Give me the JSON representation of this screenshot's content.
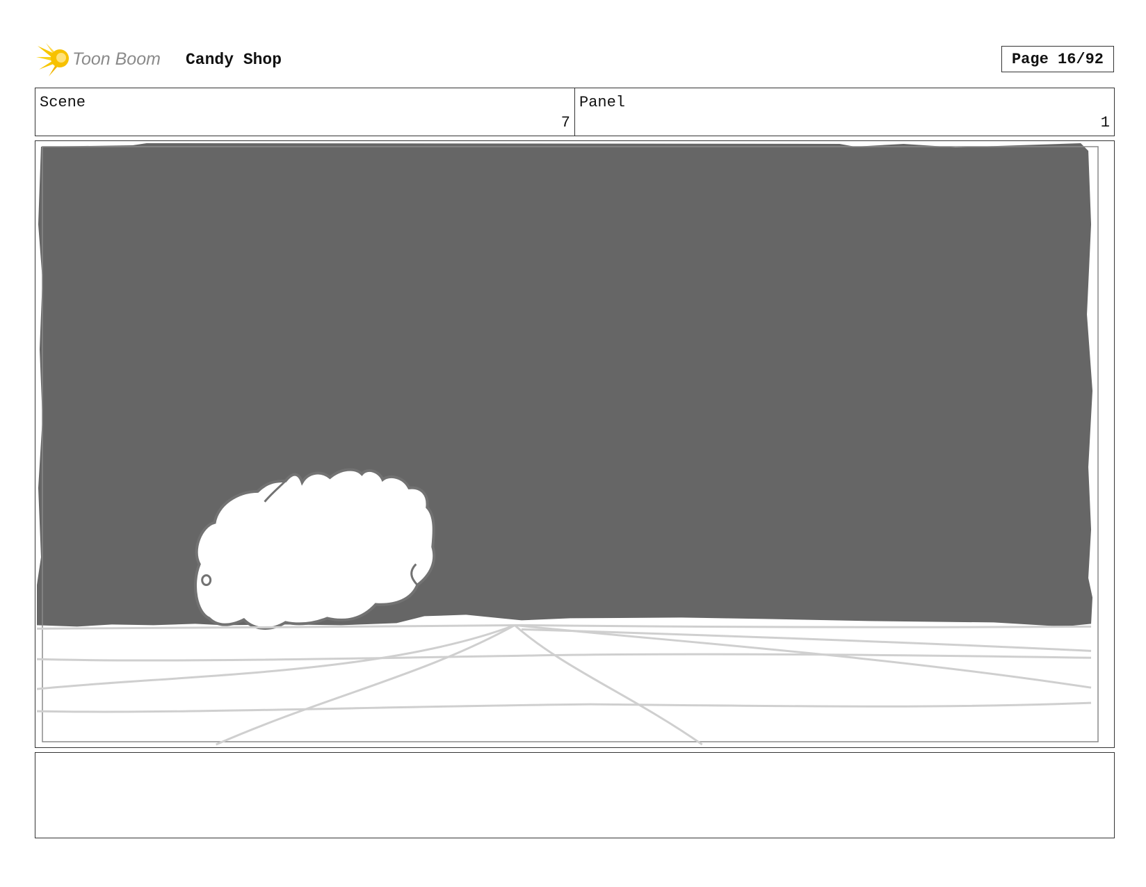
{
  "header": {
    "logo_text": "Toon Boom",
    "project_title": "Candy Shop",
    "page_label": "Page 16/92"
  },
  "info": {
    "scene_label": "Scene",
    "scene_value": "7",
    "panel_label": "Panel",
    "panel_value": "1"
  },
  "panel": {
    "sky_color": "#666666",
    "ground_color": "#ffffff",
    "bush_outline_color": "#6f6f6f",
    "ground_line_color": "#cfcfcf"
  },
  "notes": {
    "text": ""
  }
}
